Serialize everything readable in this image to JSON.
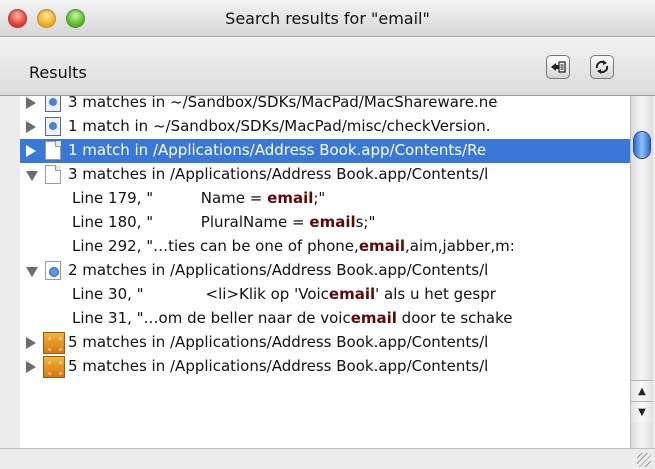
{
  "window": {
    "title": "Search results for \"email\""
  },
  "toolbar": {
    "label": "Results"
  },
  "rows": [
    {
      "type": "file",
      "icon": "image-file",
      "text": "3 matches in ~/Sandbox/SDKs/MacPad/MacShareware.ne",
      "expanded": false,
      "selected": false
    },
    {
      "type": "file",
      "icon": "image-file",
      "text": "1 match in ~/Sandbox/SDKs/MacPad/misc/checkVersion.",
      "expanded": false,
      "selected": false
    },
    {
      "type": "file",
      "icon": "document",
      "text": "1 match in /Applications/Address Book.app/Contents/Re",
      "expanded": false,
      "selected": true
    },
    {
      "type": "file",
      "icon": "document",
      "text": "3 matches in /Applications/Address Book.app/Contents/l",
      "expanded": true,
      "selected": false
    },
    {
      "type": "line",
      "pre": "Line 179, \"          Name = ",
      "kw": "email",
      "post": ";\""
    },
    {
      "type": "line",
      "pre": "Line 180, \"          PluralName = ",
      "kw": "email",
      "post": "s;\""
    },
    {
      "type": "line",
      "pre": "Line 292, \"…ties can be one of phone,",
      "kw": "email",
      "post": ",aim,jabber,m:"
    },
    {
      "type": "file",
      "icon": "web-file",
      "text": "2 matches in /Applications/Address Book.app/Contents/l",
      "expanded": true,
      "selected": false
    },
    {
      "type": "line",
      "pre": "Line 30, \"             <li>Klik op 'Voic",
      "kw": "email",
      "post": "' als u het gespr"
    },
    {
      "type": "line",
      "pre": "Line 31, \"…om de beller naar de voic",
      "kw": "email",
      "post": " door te schake"
    },
    {
      "type": "file",
      "icon": "block-file",
      "text": "5 matches in /Applications/Address Book.app/Contents/l",
      "expanded": false,
      "selected": false
    },
    {
      "type": "file",
      "icon": "block-file",
      "text": "5 matches in /Applications/Address Book.app/Contents/l",
      "expanded": false,
      "selected": false
    }
  ]
}
